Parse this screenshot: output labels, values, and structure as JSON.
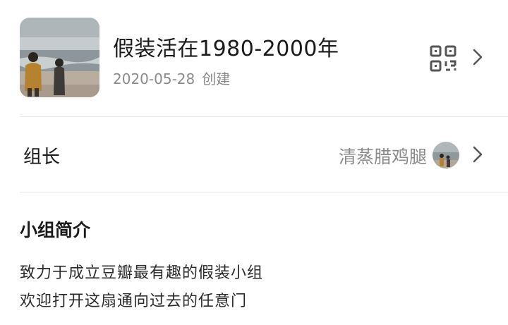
{
  "group": {
    "title": "假装活在1980-2000年",
    "created_date": "2020-05-28",
    "created_label": "创建",
    "cover_icon": "beach-photo"
  },
  "header_actions": {
    "qr_icon": "qr-code-icon",
    "chevron_icon": "chevron-right-icon"
  },
  "owner": {
    "label": "组长",
    "name": "清蒸腊鸡腿",
    "avatar_icon": "beach-avatar"
  },
  "intro": {
    "heading": "小组简介",
    "lines": [
      "致力于成立豆瓣最有趣的假装小组",
      "欢迎打开这扇通向过去的任意门"
    ]
  },
  "colors": {
    "text_primary": "#1a1a1a",
    "text_secondary": "#8a8a8a",
    "divider": "#e6e6e6",
    "icon": "#555555"
  }
}
